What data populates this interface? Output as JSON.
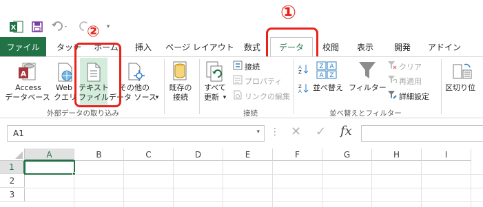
{
  "qat": {
    "excel_icon": "excel-logo-icon",
    "save_icon": "save-icon",
    "undo_icon": "undo-icon",
    "redo_icon": "redo-icon",
    "customize_icon": "customize-qat-icon"
  },
  "annotations": {
    "step1": "①",
    "step2": "②",
    "color": "#e8221b"
  },
  "tabs": [
    {
      "label": "ファイル"
    },
    {
      "label": "タッチ"
    },
    {
      "label": "ホーム"
    },
    {
      "label": "挿入"
    },
    {
      "label": "ページ レイアウト"
    },
    {
      "label": "数式"
    },
    {
      "label": "データ"
    },
    {
      "label": "校閲"
    },
    {
      "label": "表示"
    },
    {
      "label": "開発"
    },
    {
      "label": "アドイン"
    }
  ],
  "ribbon": {
    "access": {
      "line1": "Access",
      "line2": "データベース"
    },
    "web": {
      "line1": "Web",
      "line2": "クエリ"
    },
    "text": {
      "line1": "テキスト",
      "line2": "ファイル"
    },
    "other": {
      "line1": "その他の",
      "line2": "データ ソース",
      "arrow": "▾"
    },
    "existing": {
      "line1": "既存の",
      "line2": "接続"
    },
    "refresh": {
      "line1": "すべて",
      "line2": "更新",
      "arrow": "▾"
    },
    "connections": "接続",
    "properties": "プロパティ",
    "edit_links": "リンクの編集",
    "sort": "並べ替え",
    "filter": "フィルター",
    "clear": "クリア",
    "reapply": "再適用",
    "advanced": "詳細設定",
    "text_to_columns": "区切り位",
    "group_external": "外部データの取り込み",
    "group_connections": "接続",
    "group_sort_filter": "並べ替えとフィルター"
  },
  "formula_bar": {
    "name_box": "A1",
    "cancel": "✕",
    "enter": "✓",
    "fx": "fx",
    "colon": "⋮"
  },
  "grid": {
    "columns": [
      "A",
      "B",
      "C",
      "D",
      "E",
      "F",
      "G",
      "H",
      "I"
    ],
    "rows": [
      "1",
      "2",
      "3"
    ]
  },
  "colors": {
    "excel_green": "#217346",
    "annotation_red": "#e8221b"
  }
}
